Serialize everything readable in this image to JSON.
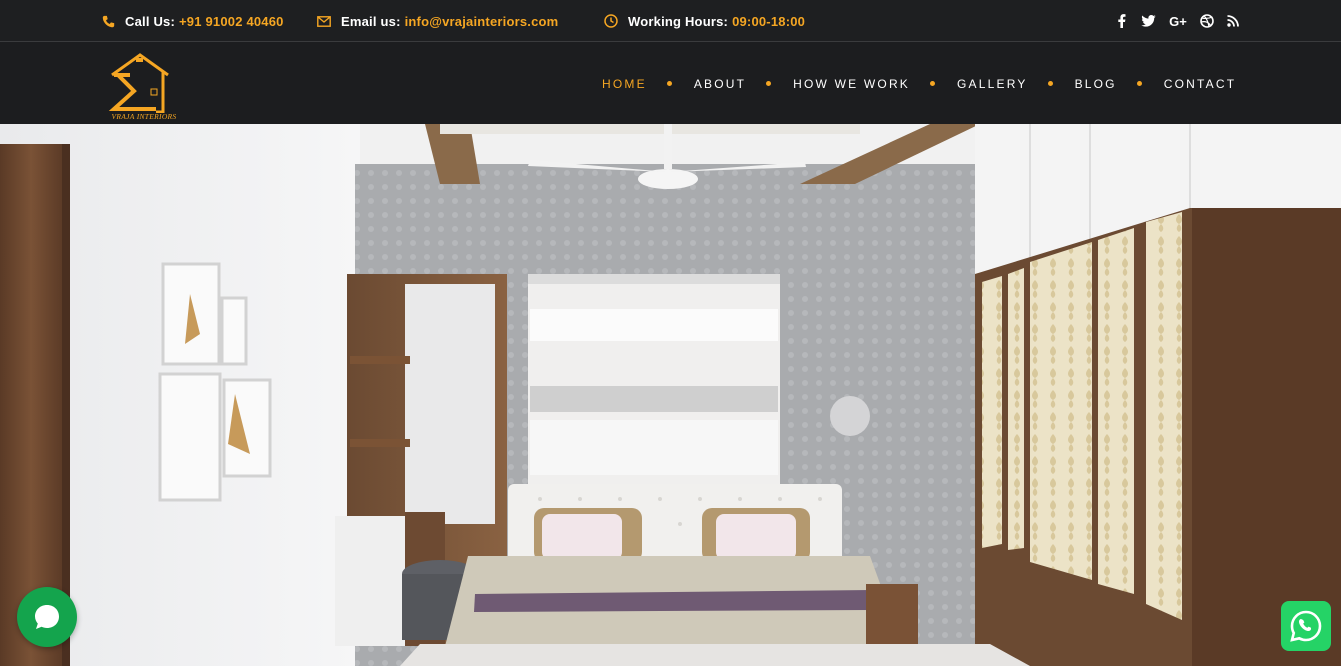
{
  "topbar": {
    "call_label": "Call Us:",
    "call_value": "+91 91002 40460",
    "email_label": "Email us:",
    "email_value": "info@vrajainteriors.com",
    "hours_label": "Working Hours:",
    "hours_value": "09:00-18:00",
    "social": [
      "facebook-icon",
      "twitter-icon",
      "google-plus-icon",
      "dribbble-icon",
      "rss-icon"
    ]
  },
  "logo": {
    "text": "VRAJA INTERIORS"
  },
  "nav": {
    "items": [
      {
        "label": "HOME",
        "active": true
      },
      {
        "label": "ABOUT"
      },
      {
        "label": "HOW WE WORK"
      },
      {
        "label": "GALLERY"
      },
      {
        "label": "BLOG"
      },
      {
        "label": "CONTACT"
      }
    ]
  },
  "colors": {
    "accent": "#f5a623",
    "bar": "#1c1d1f",
    "chat": "#14a44d",
    "whatsapp": "#25d366"
  },
  "widgets": {
    "chat": "chat-bubble-icon",
    "whatsapp": "whatsapp-icon"
  }
}
